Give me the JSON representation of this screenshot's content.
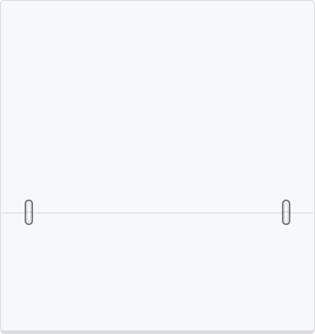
{
  "notepad": {
    "upper_page_text": "",
    "lower_page_text": "",
    "binding": {
      "ring_count": 2,
      "left_ring_icon": "binder-ring-icon",
      "right_ring_icon": "binder-ring-icon"
    },
    "colors": {
      "paper": "#f7f8fa",
      "edge": "#d3d5d9",
      "ring": "#7a7d82"
    }
  }
}
